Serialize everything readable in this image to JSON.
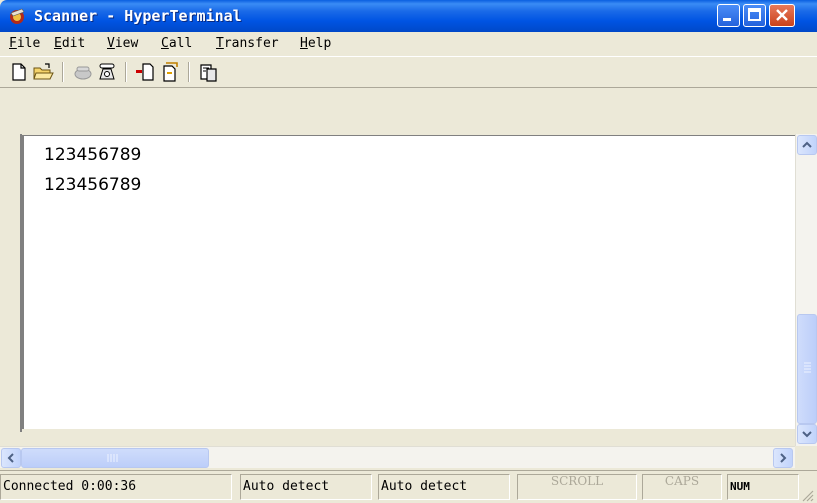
{
  "window": {
    "title": "Scanner - HyperTerminal"
  },
  "menu": {
    "items": [
      {
        "accel": "F",
        "rest": "ile"
      },
      {
        "accel": "E",
        "rest": "dit"
      },
      {
        "accel": "V",
        "rest": "iew"
      },
      {
        "accel": "C",
        "rest": "all"
      },
      {
        "accel": "T",
        "rest": "ransfer"
      },
      {
        "accel": "H",
        "rest": "elp"
      }
    ]
  },
  "toolbar": {
    "icons": [
      "new-document-icon",
      "open-folder-icon",
      "disconnect-phone-icon",
      "dial-phone-icon",
      "send-file-icon",
      "receive-file-icon",
      "properties-icon"
    ]
  },
  "terminal": {
    "lines": [
      "123456789",
      "123456789"
    ]
  },
  "status": {
    "connection": "Connected 0:00:36",
    "detect1": "Auto detect",
    "detect2": "Auto detect",
    "scroll": "SCROLL",
    "caps": "CAPS",
    "num": "NUM"
  },
  "colors": {
    "titlebar": "#0054e3",
    "chrome": "#ece9d8",
    "close": "#c9421b"
  }
}
